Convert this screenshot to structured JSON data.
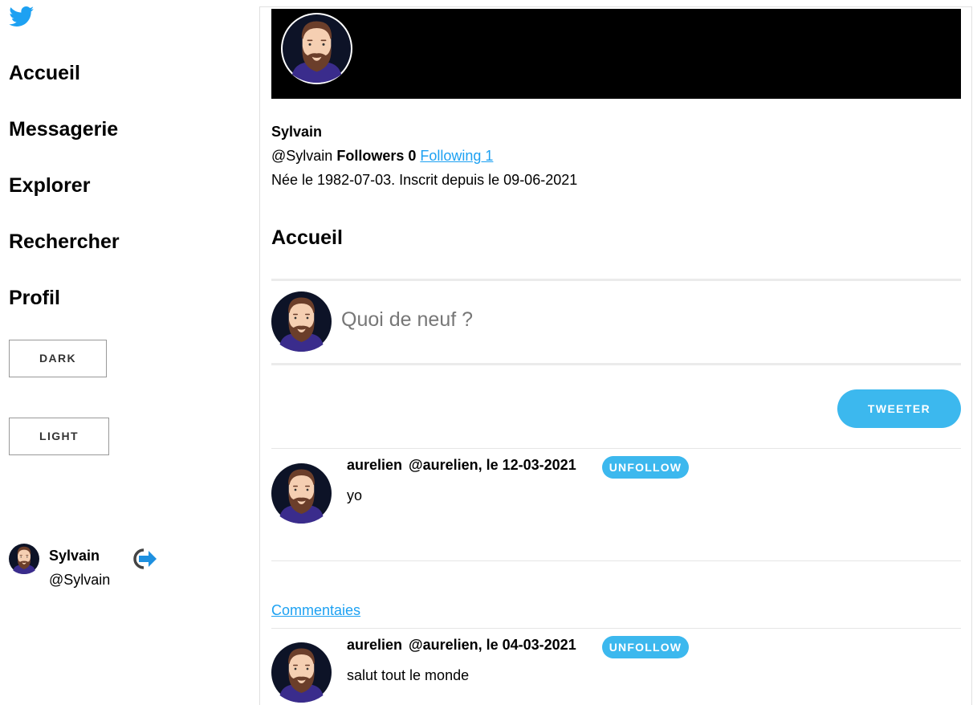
{
  "colors": {
    "accent": "#3cb8ee",
    "link": "#1da1f2",
    "banner": "#000000"
  },
  "sidebar": {
    "logo_icon": "twitter-bird-icon",
    "nav": [
      {
        "label": "Accueil"
      },
      {
        "label": "Messagerie"
      },
      {
        "label": "Explorer"
      },
      {
        "label": "Rechercher"
      },
      {
        "label": "Profil"
      }
    ],
    "theme_dark_label": "DARK",
    "theme_light_label": "LIGHT",
    "user": {
      "name": "Sylvain",
      "handle": "@Sylvain",
      "logout_icon": "logout-icon"
    }
  },
  "profile": {
    "name": "Sylvain",
    "handle": "@Sylvain",
    "followers_label": "Followers 0",
    "following_label": "Following 1",
    "bio": "Née le 1982-07-03. Inscrit depuis le 09-06-2021"
  },
  "main": {
    "section_title": "Accueil",
    "compose_placeholder": "Quoi de neuf ?",
    "tweet_button": "TWEETER",
    "comments_link": "Commentaies"
  },
  "tweets": [
    {
      "author": "aurelien",
      "meta": "@aurelien, le 12-03-2021",
      "action": "UNFOLLOW",
      "text": "yo"
    },
    {
      "author": "aurelien",
      "meta": "@aurelien, le 04-03-2021",
      "action": "UNFOLLOW",
      "text": "salut tout le monde"
    }
  ]
}
